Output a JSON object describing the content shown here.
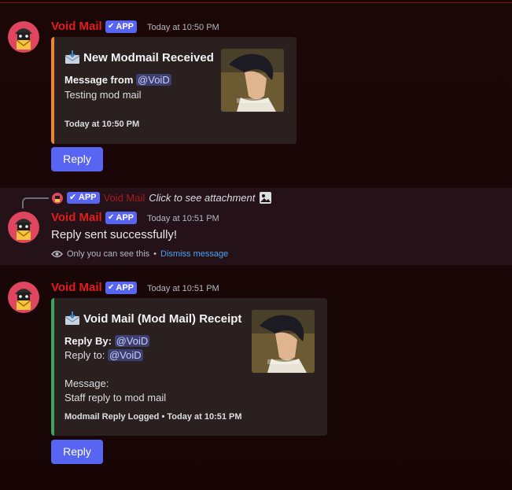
{
  "bot": {
    "name": "Void Mail",
    "app_tag": "APP",
    "check_glyph": "✔"
  },
  "messages": [
    {
      "time": "Today at 10:50 PM",
      "embed": {
        "title": "New Modmail Received",
        "from_label": "Message from",
        "from_mention": "@VoiD",
        "body": "Testing mod mail",
        "footer": "Today at 10:50 PM",
        "accent_color": "#f0832d"
      },
      "button_label": "Reply"
    },
    {
      "reference": {
        "app_tag": "APP",
        "name": "Void Mail",
        "text": "Click to see attachment"
      },
      "time": "Today at 10:51 PM",
      "content": "Reply sent successfully!",
      "ephemeral_note": "Only you can see this",
      "separator": "•",
      "dismiss_label": "Dismiss message"
    },
    {
      "time": "Today at 10:51 PM",
      "embed": {
        "title": "Void Mail (Mod Mail) Receipt",
        "reply_by_label": "Reply By:",
        "reply_by_mention": "@VoiD",
        "reply_to_label": "Reply to:",
        "reply_to_mention": "@VoiD",
        "message_label": "Message:",
        "message_body": "Staff reply to mod mail",
        "footer": "Modmail Reply Logged • Today at 10:51 PM",
        "accent_color": "#3ba55d"
      },
      "button_label": "Reply"
    }
  ],
  "colors": {
    "bot_name": "#e21d1d",
    "app_badge": "#5865f2",
    "button": "#5865f2",
    "link": "#4ea3f5"
  },
  "icons": {
    "avatar": "envelope-bot-avatar-icon",
    "embed_title": "incoming-envelope-icon",
    "reference_attachment": "image-icon",
    "ephemeral": "eye-icon"
  }
}
